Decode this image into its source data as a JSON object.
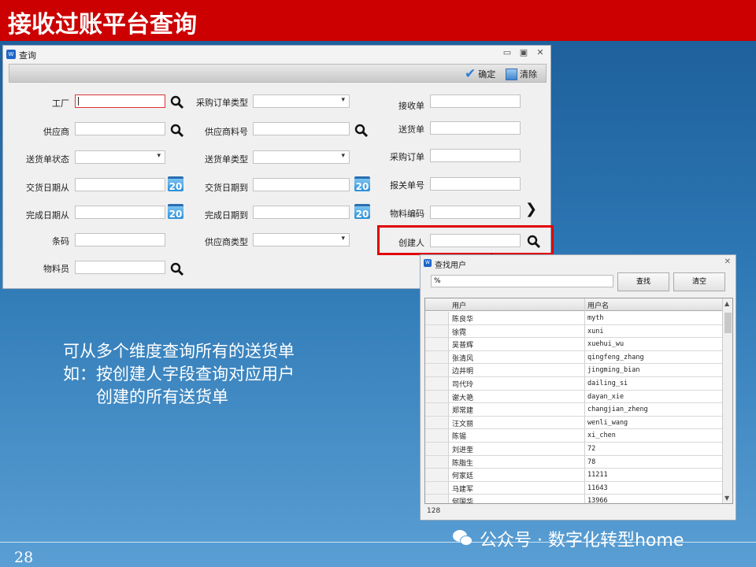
{
  "slide_title": "接收过账平台查询",
  "query_window": {
    "title": "查询",
    "toolbar": {
      "confirm_label": "确定",
      "clear_label": "清除"
    },
    "fields": [
      {
        "label": "工厂"
      },
      {
        "label": "供应商"
      },
      {
        "label": "送货单状态"
      },
      {
        "label": "交货日期从"
      },
      {
        "label": "完成日期从"
      },
      {
        "label": "条码"
      },
      {
        "label": "物料员"
      },
      {
        "label": "采购订单类型"
      },
      {
        "label": "供应商料号"
      },
      {
        "label": "送货单类型"
      },
      {
        "label": "交货日期到"
      },
      {
        "label": "完成日期到"
      },
      {
        "label": "供应商类型"
      },
      {
        "label": "接收单"
      },
      {
        "label": "送货单"
      },
      {
        "label": "采购订单"
      },
      {
        "label": "报关单号"
      },
      {
        "label": "物料编码"
      },
      {
        "label": "创建人"
      }
    ],
    "calendar_day": "20"
  },
  "lookup_dialog": {
    "title": "查找用户",
    "search_value": "%",
    "find_label": "查找",
    "clear_label": "清空",
    "columns": [
      "用户",
      "用户名"
    ],
    "rows": [
      [
        "陈良华",
        "myth"
      ],
      [
        "徐霓",
        "xuni"
      ],
      [
        "吴普辉",
        "xuehui_wu"
      ],
      [
        "张清风",
        "qingfeng_zhang"
      ],
      [
        "边井明",
        "jingming_bian"
      ],
      [
        "司代玲",
        "dailing_si"
      ],
      [
        "谢大艳",
        "dayan_xie"
      ],
      [
        "郑常建",
        "changjian_zheng"
      ],
      [
        "汪文丽",
        "wenli_wang"
      ],
      [
        "陈锡",
        "xi_chen"
      ],
      [
        "刘进奎",
        "72"
      ],
      [
        "陈脂生",
        "78"
      ],
      [
        "何家廷",
        "11211"
      ],
      [
        "马建军",
        "11643"
      ],
      [
        "何国华",
        "13966"
      ]
    ],
    "record_count": "128"
  },
  "description": [
    "可从多个维度查询所有的送货单",
    "如：按创建人字段查询对应用户",
    "　　创建的所有送货单"
  ],
  "watermark": "公众号 · 数字化转型home",
  "page_number": "28"
}
